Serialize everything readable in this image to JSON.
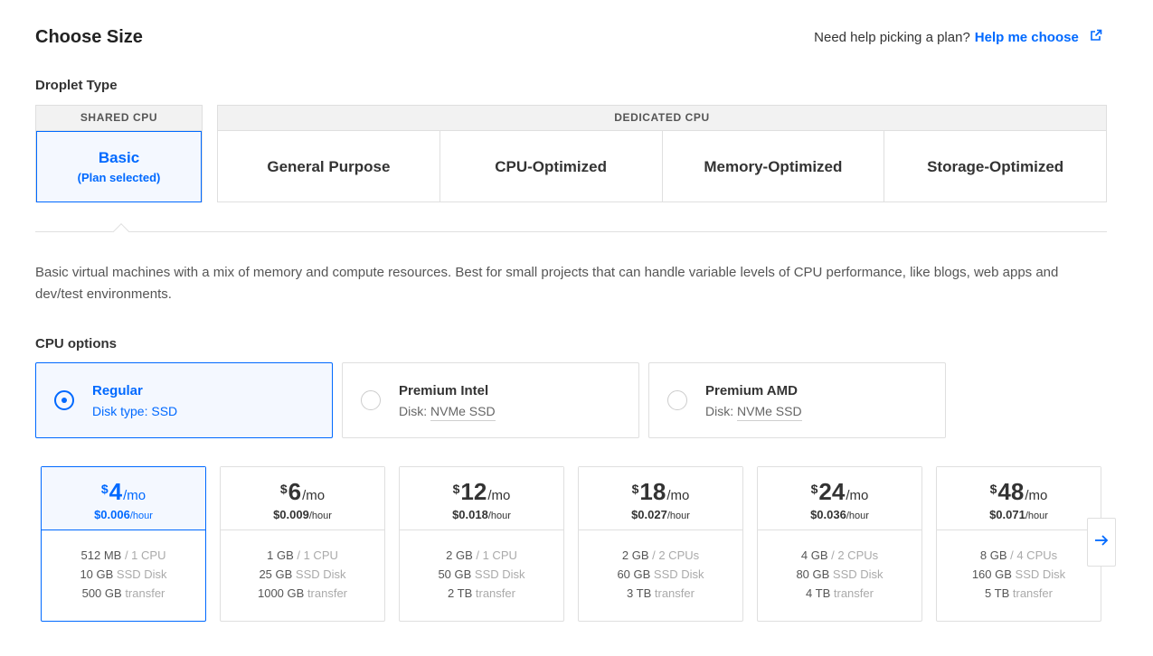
{
  "header": {
    "title": "Choose Size",
    "help_text": "Need help picking a plan?",
    "help_link": "Help me choose",
    "help_link_icon": "external-link-icon"
  },
  "droplet_type": {
    "label": "Droplet Type",
    "shared_header": "SHARED CPU",
    "dedicated_header": "DEDICATED CPU",
    "basic_label": "Basic",
    "basic_sub": "(Plan selected)",
    "dedicated_tabs": [
      {
        "label": "General Purpose"
      },
      {
        "label": "CPU-Optimized"
      },
      {
        "label": "Memory-Optimized"
      },
      {
        "label": "Storage-Optimized"
      }
    ]
  },
  "description": "Basic virtual machines with a mix of memory and compute resources. Best for small projects that can handle variable levels of CPU performance, like blogs, web apps and dev/test environments.",
  "cpu_options": {
    "label": "CPU options",
    "items": [
      {
        "name": "Regular",
        "disk_label": "Disk type:",
        "disk_value": "SSD"
      },
      {
        "name": "Premium Intel",
        "disk_label": "Disk:",
        "disk_value": "NVMe SSD"
      },
      {
        "name": "Premium AMD",
        "disk_label": "Disk:",
        "disk_value": "NVMe SSD"
      }
    ]
  },
  "plans": [
    {
      "currency": "$",
      "amount": "4",
      "per": "/mo",
      "hourly": "$0.006",
      "hourly_unit": "/hour",
      "memory": "512 MB",
      "cpu": "/ 1 CPU",
      "disk": "10 GB",
      "disk_unit": "SSD Disk",
      "transfer": "500 GB",
      "transfer_unit": "transfer"
    },
    {
      "currency": "$",
      "amount": "6",
      "per": "/mo",
      "hourly": "$0.009",
      "hourly_unit": "/hour",
      "memory": "1 GB",
      "cpu": "/ 1 CPU",
      "disk": "25 GB",
      "disk_unit": "SSD Disk",
      "transfer": "1000 GB",
      "transfer_unit": "transfer"
    },
    {
      "currency": "$",
      "amount": "12",
      "per": "/mo",
      "hourly": "$0.018",
      "hourly_unit": "/hour",
      "memory": "2 GB",
      "cpu": "/ 1 CPU",
      "disk": "50 GB",
      "disk_unit": "SSD Disk",
      "transfer": "2 TB",
      "transfer_unit": "transfer"
    },
    {
      "currency": "$",
      "amount": "18",
      "per": "/mo",
      "hourly": "$0.027",
      "hourly_unit": "/hour",
      "memory": "2 GB",
      "cpu": "/ 2 CPUs",
      "disk": "60 GB",
      "disk_unit": "SSD Disk",
      "transfer": "3 TB",
      "transfer_unit": "transfer"
    },
    {
      "currency": "$",
      "amount": "24",
      "per": "/mo",
      "hourly": "$0.036",
      "hourly_unit": "/hour",
      "memory": "4 GB",
      "cpu": "/ 2 CPUs",
      "disk": "80 GB",
      "disk_unit": "SSD Disk",
      "transfer": "4 TB",
      "transfer_unit": "transfer"
    },
    {
      "currency": "$",
      "amount": "48",
      "per": "/mo",
      "hourly": "$0.071",
      "hourly_unit": "/hour",
      "memory": "8 GB",
      "cpu": "/ 4 CPUs",
      "disk": "160 GB",
      "disk_unit": "SSD Disk",
      "transfer": "5 TB",
      "transfer_unit": "transfer"
    }
  ],
  "carousel": {
    "next_icon": "arrow-right-icon"
  },
  "colors": {
    "accent": "#0069ff",
    "selected_bg": "#f4f8ff",
    "border": "#dfdfdf"
  }
}
